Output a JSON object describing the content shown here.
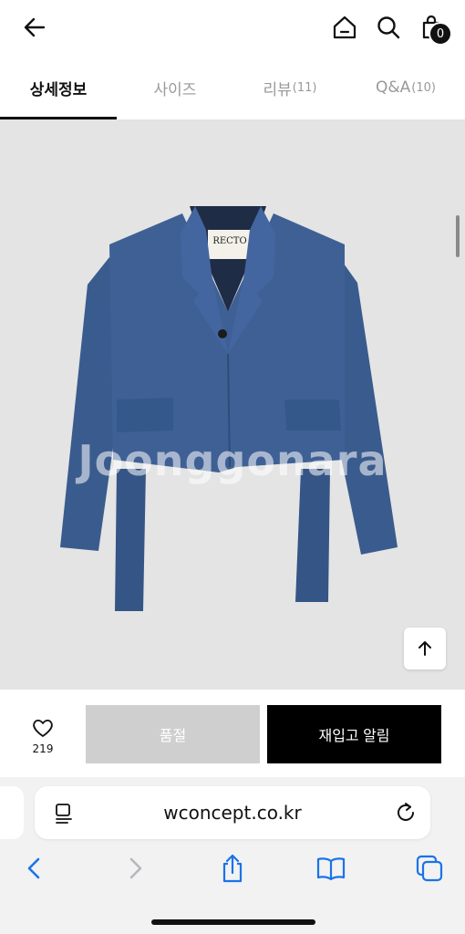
{
  "header": {
    "back_icon": "arrow-left-icon",
    "home_icon": "home-icon",
    "search_icon": "search-icon",
    "cart_icon": "shopping-bag-icon",
    "cart_count": "0"
  },
  "tabs": [
    {
      "label": "상세정보",
      "count": "",
      "active": true
    },
    {
      "label": "사이즈",
      "count": "",
      "active": false
    },
    {
      "label": "리뷰",
      "count": "(11)",
      "active": false
    },
    {
      "label": "Q&A",
      "count": "(10)",
      "active": false
    }
  ],
  "product": {
    "label_text": "RECTO",
    "watermark": "Joonggonara",
    "colors": {
      "jacket": "#3d5f92",
      "background": "#e4e4e4"
    }
  },
  "actions": {
    "like_count": "219",
    "soldout_label": "품절",
    "restock_label": "재입고 알림"
  },
  "browser": {
    "url": "wconcept.co.kr"
  }
}
